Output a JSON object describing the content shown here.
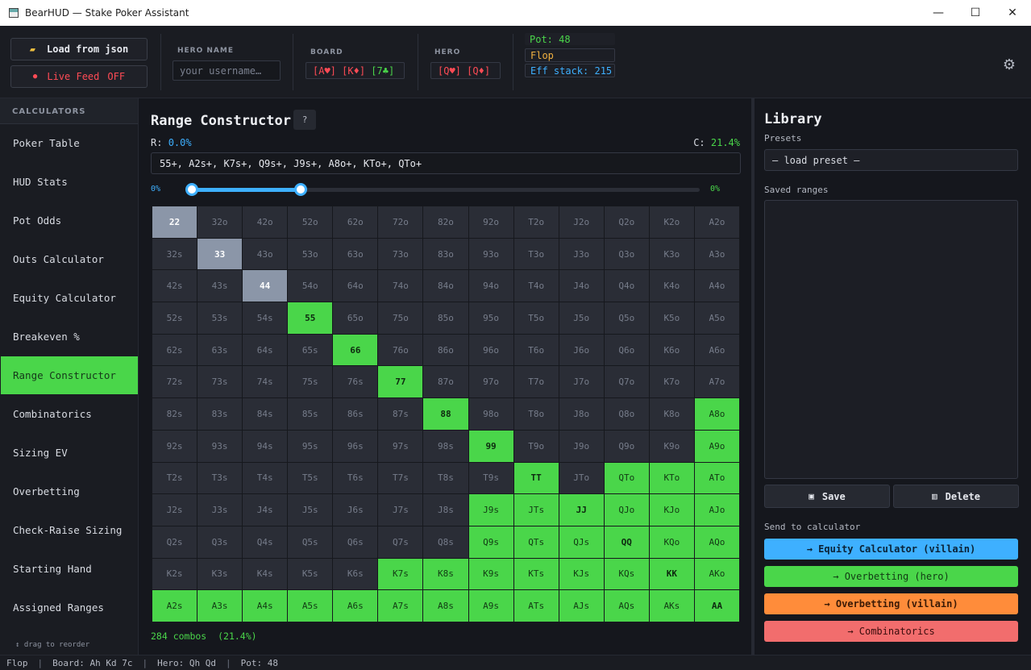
{
  "window": {
    "title": "BearHUD — Stake Poker Assistant",
    "minimize": "—",
    "maximize": "☐",
    "close": "✕"
  },
  "toolbar": {
    "load_label": "Load from json",
    "load_icon": "folder-icon",
    "live_label": "Live Feed",
    "live_state": "OFF",
    "hero_name_label": "HERO NAME",
    "hero_name_placeholder": "your username…",
    "board_label": "BOARD",
    "board_cards": [
      "[A♥]",
      "[K♦]",
      "[7♣]"
    ],
    "hero_label": "HERO",
    "hero_cards": [
      "[Q♥]",
      "[Q♦]"
    ],
    "pot": "Pot: 48",
    "street": "Flop",
    "eff_stack": "Eff stack: 215",
    "settings_icon": "gear-icon"
  },
  "sidebar": {
    "header": "CALCULATORS",
    "items": [
      "Poker Table",
      "HUD Stats",
      "Pot Odds",
      "Outs Calculator",
      "Equity Calculator",
      "Breakeven %",
      "Range Constructor",
      "Combinatorics",
      "Sizing EV",
      "Overbetting",
      "Check-Raise Sizing",
      "Starting Hand",
      "Assigned Ranges"
    ],
    "active_index": 6,
    "drag_hint": "↕ drag to reorder"
  },
  "range_constructor": {
    "title": "Range Constructor",
    "help_label": "?",
    "r_label": "R:",
    "r_value": "0.0%",
    "c_label": "C:",
    "c_value": "21.4%",
    "range_text": "55+, A2s+, K7s+, Q9s+, J9s+, A8o+, KTo+, QTo+",
    "slider_low_label": "0%",
    "slider_high_label": "0%",
    "slider_low": 0.0,
    "slider_high": 0.214,
    "grid_rows": [
      [
        "22",
        "32o",
        "42o",
        "52o",
        "62o",
        "72o",
        "82o",
        "92o",
        "T2o",
        "J2o",
        "Q2o",
        "K2o",
        "A2o"
      ],
      [
        "32s",
        "33",
        "43o",
        "53o",
        "63o",
        "73o",
        "83o",
        "93o",
        "T3o",
        "J3o",
        "Q3o",
        "K3o",
        "A3o"
      ],
      [
        "42s",
        "43s",
        "44",
        "54o",
        "64o",
        "74o",
        "84o",
        "94o",
        "T4o",
        "J4o",
        "Q4o",
        "K4o",
        "A4o"
      ],
      [
        "52s",
        "53s",
        "54s",
        "55",
        "65o",
        "75o",
        "85o",
        "95o",
        "T5o",
        "J5o",
        "Q5o",
        "K5o",
        "A5o"
      ],
      [
        "62s",
        "63s",
        "64s",
        "65s",
        "66",
        "76o",
        "86o",
        "96o",
        "T6o",
        "J6o",
        "Q6o",
        "K6o",
        "A6o"
      ],
      [
        "72s",
        "73s",
        "74s",
        "75s",
        "76s",
        "77",
        "87o",
        "97o",
        "T7o",
        "J7o",
        "Q7o",
        "K7o",
        "A7o"
      ],
      [
        "82s",
        "83s",
        "84s",
        "85s",
        "86s",
        "87s",
        "88",
        "98o",
        "T8o",
        "J8o",
        "Q8o",
        "K8o",
        "A8o"
      ],
      [
        "92s",
        "93s",
        "94s",
        "95s",
        "96s",
        "97s",
        "98s",
        "99",
        "T9o",
        "J9o",
        "Q9o",
        "K9o",
        "A9o"
      ],
      [
        "T2s",
        "T3s",
        "T4s",
        "T5s",
        "T6s",
        "T7s",
        "T8s",
        "T9s",
        "TT",
        "JTo",
        "QTo",
        "KTo",
        "ATo"
      ],
      [
        "J2s",
        "J3s",
        "J4s",
        "J5s",
        "J6s",
        "J7s",
        "J8s",
        "J9s",
        "JTs",
        "JJ",
        "QJo",
        "KJo",
        "AJo"
      ],
      [
        "Q2s",
        "Q3s",
        "Q4s",
        "Q5s",
        "Q6s",
        "Q7s",
        "Q8s",
        "Q9s",
        "QTs",
        "QJs",
        "QQ",
        "KQo",
        "AQo"
      ],
      [
        "K2s",
        "K3s",
        "K4s",
        "K5s",
        "K6s",
        "K7s",
        "K8s",
        "K9s",
        "KTs",
        "KJs",
        "KQs",
        "KK",
        "AKo"
      ],
      [
        "A2s",
        "A3s",
        "A4s",
        "A5s",
        "A6s",
        "A7s",
        "A8s",
        "A9s",
        "ATs",
        "AJs",
        "AQs",
        "AKs",
        "AA"
      ]
    ],
    "selected_hands": [
      "55",
      "66",
      "77",
      "88",
      "99",
      "TT",
      "JJ",
      "QQ",
      "KK",
      "AA",
      "A2s",
      "A3s",
      "A4s",
      "A5s",
      "A6s",
      "A7s",
      "A8s",
      "A9s",
      "ATs",
      "AJs",
      "AQs",
      "AKs",
      "K7s",
      "K8s",
      "K9s",
      "KTs",
      "KJs",
      "KQs",
      "Q9s",
      "QTs",
      "QJs",
      "J9s",
      "JTs",
      "A8o",
      "A9o",
      "ATo",
      "AJo",
      "AQo",
      "AKo",
      "KTo",
      "KJo",
      "KQo",
      "QTo",
      "QJo"
    ],
    "highlighted_hands": [
      "22",
      "33",
      "44"
    ],
    "combos": "284 combos",
    "combos_pct": "(21.4%)",
    "colors": {
      "selected": "#4ad64a",
      "highlighted": "#8b96a8",
      "empty": "#2a2d36"
    }
  },
  "library": {
    "title": "Library",
    "presets_label": "Presets",
    "preset_value": "— load preset —",
    "saved_label": "Saved ranges",
    "save_label": "Save",
    "save_icon": "floppy-disk-icon",
    "delete_label": "Delete",
    "delete_icon": "trash-icon",
    "send_label": "Send to calculator",
    "send_buttons": [
      "→ Equity Calculator (villain)",
      "→ Overbetting (hero)",
      "→ Overbetting (villain)",
      "→ Combinatorics"
    ]
  },
  "statusbar": {
    "street": "Flop",
    "board": "Board: Ah Kd 7c",
    "hero": "Hero: Qh Qd",
    "pot": "Pot: 48"
  }
}
